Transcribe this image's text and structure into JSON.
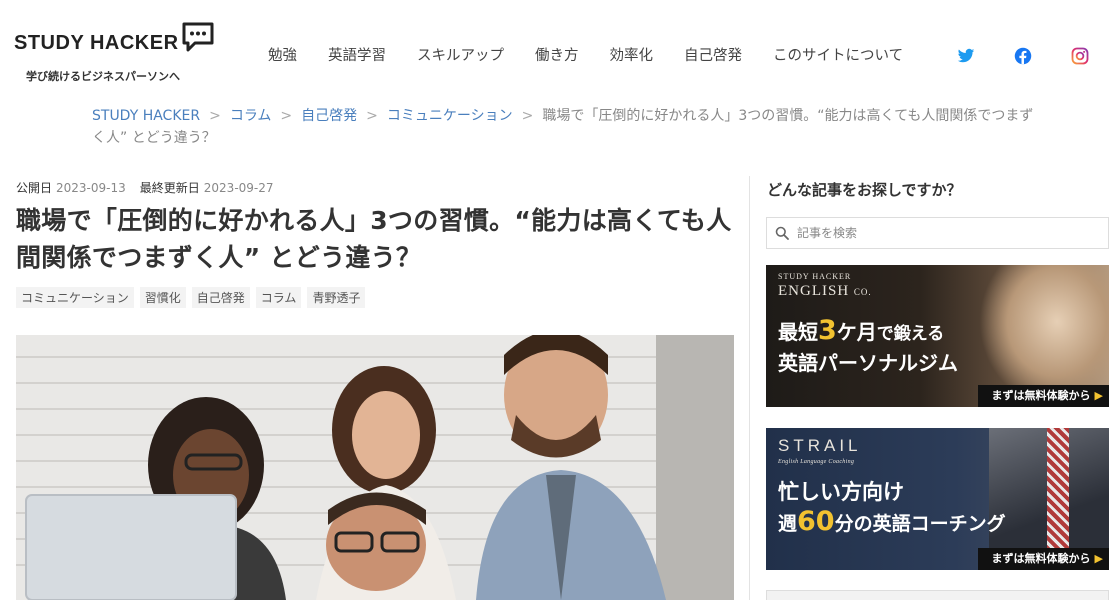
{
  "header": {
    "logo_text": "STUDY HACKER",
    "tagline": "学び続けるビジネスパーソンへ",
    "nav": [
      "勉強",
      "英語学習",
      "スキルアップ",
      "働き方",
      "効率化",
      "自己啓発",
      "このサイトについて"
    ],
    "social": [
      "twitter-icon",
      "facebook-icon",
      "instagram-icon"
    ]
  },
  "breadcrumb": {
    "items": [
      "STUDY HACKER",
      "コラム",
      "自己啓発",
      "コミュニケーション"
    ],
    "separator": ">",
    "current": "職場で「圧倒的に好かれる人」3つの習慣。“能力は高くても人間関係でつまずく人” とどう違う？"
  },
  "article": {
    "published_label": "公開日",
    "published_date": "2023-09-13",
    "updated_label": "最終更新日",
    "updated_date": "2023-09-27",
    "title": "職場で「圧倒的に好かれる人」3つの習慣。“能力は高くても人間関係でつまずく人” とどう違う？",
    "tags": [
      "コミュニケーション",
      "習慣化",
      "自己啓発",
      "コラム",
      "青野透子"
    ]
  },
  "sidebar": {
    "title": "どんな記事をお探しですか？",
    "search_placeholder": "記事を検索",
    "banner1": {
      "brand_top": "STUDY HACKER",
      "brand": "ENGLISH",
      "brand_suffix": "CO.",
      "line1_a": "最短",
      "line1_num": "3",
      "line1_b": "ケ月",
      "line1_c": "で鍛える",
      "line2": "英語パーソナルジム",
      "cta": "まずは無料体験から"
    },
    "banner2": {
      "brand": "STRAIL",
      "sub": "English Language Coaching",
      "line1": "忙しい方向け",
      "line2_a": "週",
      "line2_num": "60",
      "line2_b": "分",
      "line2_c": "の英語コーチング",
      "cta": "まずは無料体験から"
    }
  },
  "colors": {
    "link": "#4a7fbd",
    "twitter": "#1d9bf0",
    "facebook": "#1877f2",
    "banner_accent": "#f2c230"
  }
}
